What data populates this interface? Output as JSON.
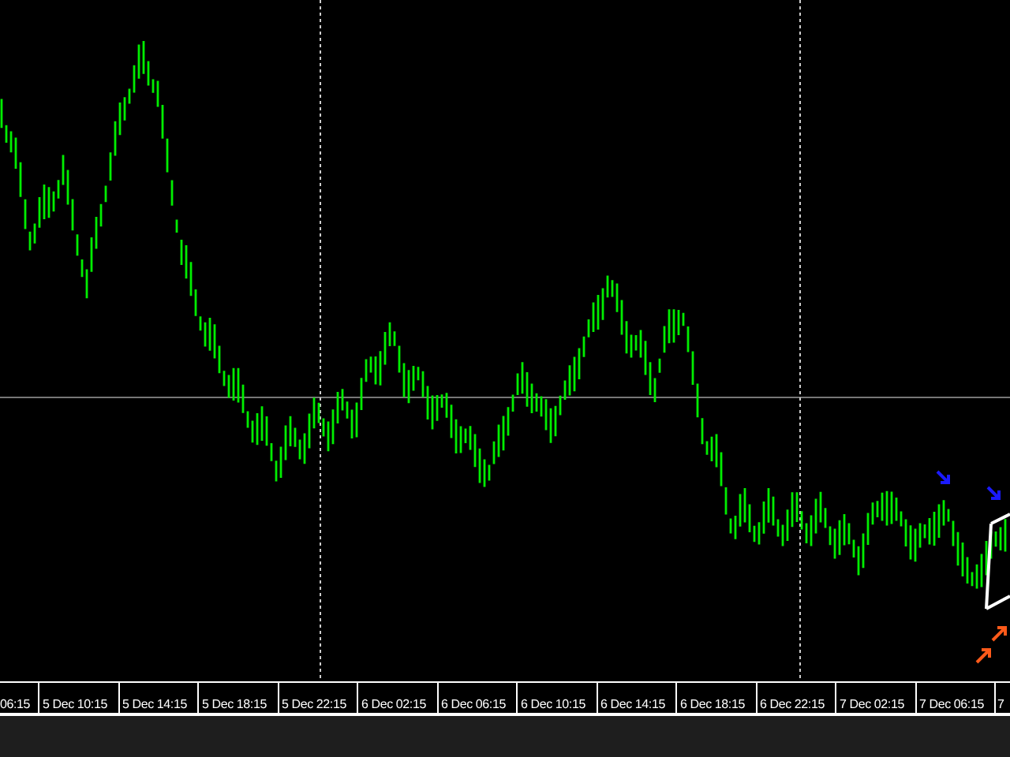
{
  "time_axis": {
    "labels": [
      "06:15",
      "5 Dec 10:15",
      "5 Dec 14:15",
      "5 Dec 18:15",
      "5 Dec 22:15",
      "6 Dec 02:15",
      "6 Dec 06:15",
      "6 Dec 10:15",
      "6 Dec 14:15",
      "6 Dec 18:15",
      "6 Dec 22:15",
      "7 Dec 02:15",
      "7 Dec 06:15",
      "7"
    ]
  }
}
